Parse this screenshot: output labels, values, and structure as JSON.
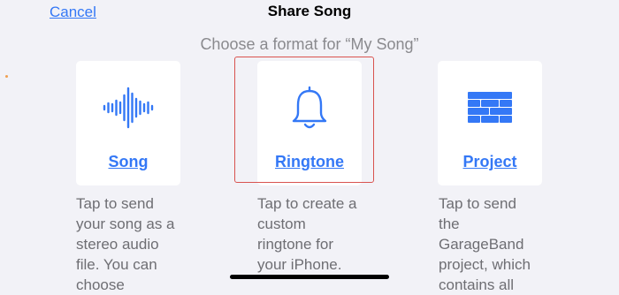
{
  "nav": {
    "cancel_label": "Cancel",
    "title": "Share Song"
  },
  "subtitle": "Choose a format for “My Song”",
  "accent_color": "#3478f6",
  "selection_color": "#d9534f",
  "options": [
    {
      "label": "Song",
      "icon": "waveform-icon",
      "selected": false,
      "description_lines": [
        "Tap to send",
        "your song as a",
        "stereo audio",
        "file. You can",
        "choose"
      ]
    },
    {
      "label": "Ringtone",
      "icon": "bell-icon",
      "selected": true,
      "description_lines": [
        "Tap to create a",
        "custom",
        "ringtone for",
        "your iPhone."
      ]
    },
    {
      "label": "Project",
      "icon": "brick-wall-icon",
      "selected": false,
      "description_lines": [
        "Tap to send",
        "the",
        "GarageBand",
        "project, which",
        "contains all"
      ]
    }
  ]
}
